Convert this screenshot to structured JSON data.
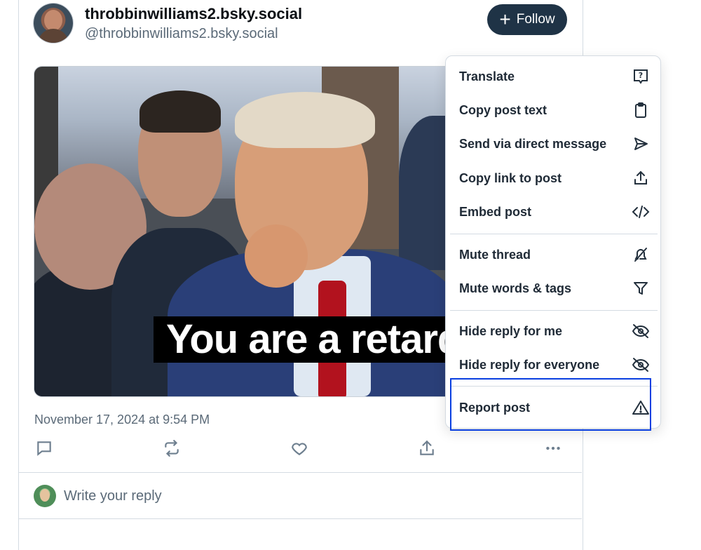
{
  "post": {
    "author_display": "throbbinwilliams2.bsky.social",
    "author_handle": "@throbbinwilliams2.bsky.social",
    "follow_label": "Follow",
    "media_caption": "You are a retard",
    "date": "November 17, 2024 at 9:54 PM"
  },
  "actions": {
    "reply_icon": "comment-icon",
    "repost_icon": "repost-icon",
    "like_icon": "heart-icon",
    "share_icon": "share-icon",
    "more_icon": "more-dots-icon"
  },
  "reply_box": {
    "placeholder": "Write your reply"
  },
  "menu": {
    "items": [
      {
        "label": "Translate",
        "icon": "translate-icon"
      },
      {
        "label": "Copy post text",
        "icon": "clipboard-icon"
      },
      {
        "label": "Send via direct message",
        "icon": "send-icon"
      },
      {
        "label": "Copy link to post",
        "icon": "share-icon"
      },
      {
        "label": "Embed post",
        "icon": "code-icon"
      },
      {
        "label": "Mute thread",
        "icon": "mute-icon"
      },
      {
        "label": "Mute words & tags",
        "icon": "filter-icon"
      },
      {
        "label": "Hide reply for me",
        "icon": "eye-off-icon"
      },
      {
        "label": "Hide reply for everyone",
        "icon": "eye-off-icon"
      },
      {
        "label": "Report post",
        "icon": "warning-icon"
      }
    ]
  },
  "colors": {
    "follow_bg": "#1f3346",
    "highlight_border": "#0a3fe0",
    "muted_text": "#5b6a78"
  }
}
